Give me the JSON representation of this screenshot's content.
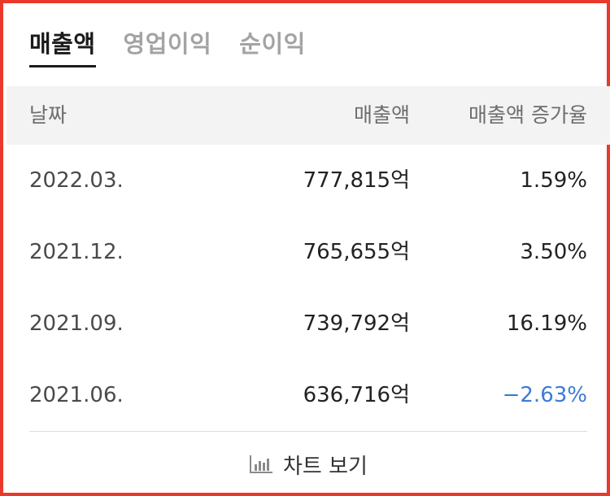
{
  "tabs": [
    {
      "label": "매출액",
      "active": true
    },
    {
      "label": "영업이익",
      "active": false
    },
    {
      "label": "순이익",
      "active": false
    }
  ],
  "table": {
    "headers": {
      "date": "날짜",
      "sales": "매출액",
      "growth": "매출액 증가율"
    },
    "rows": [
      {
        "date": "2022.03.",
        "sales": "777,815억",
        "growth": "1.59%"
      },
      {
        "date": "2021.12.",
        "sales": "765,655억",
        "growth": "3.50%"
      },
      {
        "date": "2021.09.",
        "sales": "739,792억",
        "growth": "16.19%"
      },
      {
        "date": "2021.06.",
        "sales": "636,716억",
        "growth": "−2.63%"
      }
    ]
  },
  "chart_button": {
    "label": "차트 보기",
    "icon": "bar-chart-icon"
  },
  "colors": {
    "border": "#e9392b",
    "negative": "#3d7ad6",
    "header_bg": "#f3f3f3"
  }
}
